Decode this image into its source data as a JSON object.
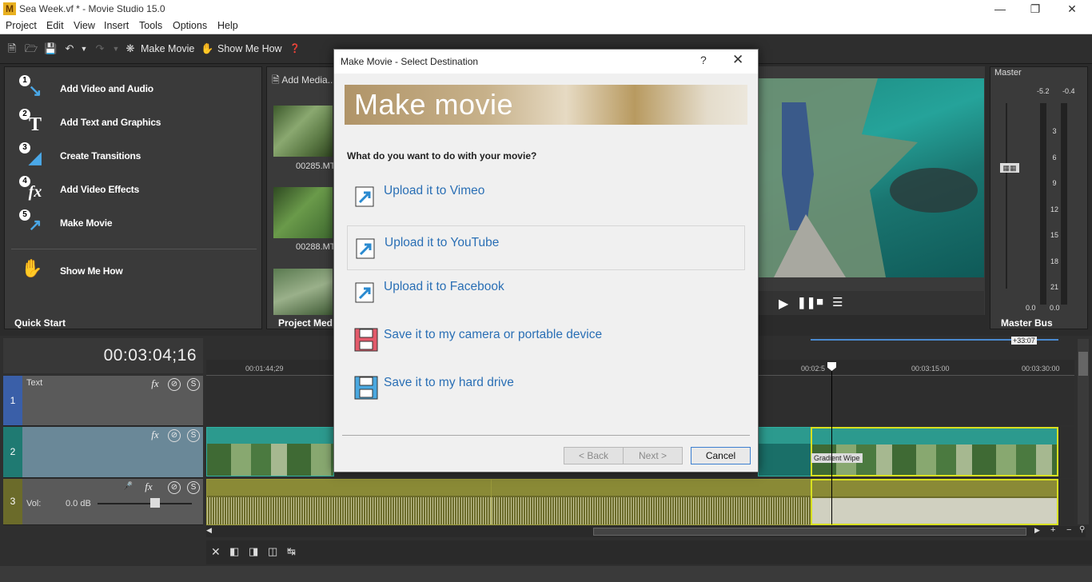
{
  "window": {
    "title": "Sea Week.vf * - Movie Studio 15.0",
    "app_icon": "M"
  },
  "menu": [
    "Project",
    "Edit",
    "View",
    "Insert",
    "Tools",
    "Options",
    "Help"
  ],
  "toolbar": {
    "make_movie": "Make Movie",
    "show_me_how": "Show Me How"
  },
  "quick_start": {
    "items": [
      {
        "num": "1",
        "label": "Add Video and Audio"
      },
      {
        "num": "2",
        "label": "Add Text and Graphics"
      },
      {
        "num": "3",
        "label": "Create Transitions"
      },
      {
        "num": "4",
        "label": "Add Video Effects"
      },
      {
        "num": "5",
        "label": "Make Movie"
      }
    ],
    "show_me_how": "Show Me How",
    "tab": "Quick Start"
  },
  "project_media": {
    "add_media": "Add Media...",
    "thumbs": [
      "00285.MT",
      "00288.MT"
    ],
    "tab": "Project Med"
  },
  "master": {
    "title": "Master",
    "peak_left": "-5.2",
    "peak_right": "-0.4",
    "scale": [
      "3",
      "6",
      "9",
      "12",
      "15",
      "18",
      "21"
    ],
    "bottom_left": "0.0",
    "bottom_right": "0.0",
    "tab": "Master Bus"
  },
  "timeline": {
    "timecode": "00:03:04;16",
    "ruler": [
      "00:01:44;29",
      "00:02:5",
      "00:03:15:00",
      "00:03:30:00"
    ],
    "region": "+33:07",
    "tracks": [
      {
        "num": "1",
        "name": "Text"
      },
      {
        "num": "2",
        "name": ""
      },
      {
        "num": "3",
        "name": "Vol:",
        "vol": "0.0 dB"
      }
    ],
    "transition": "Gradient Wipe"
  },
  "dialog": {
    "title": "Make Movie - Select Destination",
    "help": "?",
    "banner": "Make movie",
    "question": "What do you want to do with your movie?",
    "options": [
      {
        "label": "Upload it to Vimeo",
        "icon": "upload-icon"
      },
      {
        "label": "Upload it to YouTube",
        "icon": "upload-icon"
      },
      {
        "label": "Upload it to Facebook",
        "icon": "upload-icon"
      },
      {
        "label": "Save it to my camera or portable device",
        "icon": "save-red-icon"
      },
      {
        "label": "Save it to my hard drive",
        "icon": "save-blue-icon"
      }
    ],
    "back": "< Back",
    "next": "Next >",
    "cancel": "Cancel"
  },
  "colors": {
    "accent": "#2a6fb5",
    "video_clip": "#2c9a8e",
    "audio_clip": "#8a8a36",
    "selection": "#d8e020"
  }
}
